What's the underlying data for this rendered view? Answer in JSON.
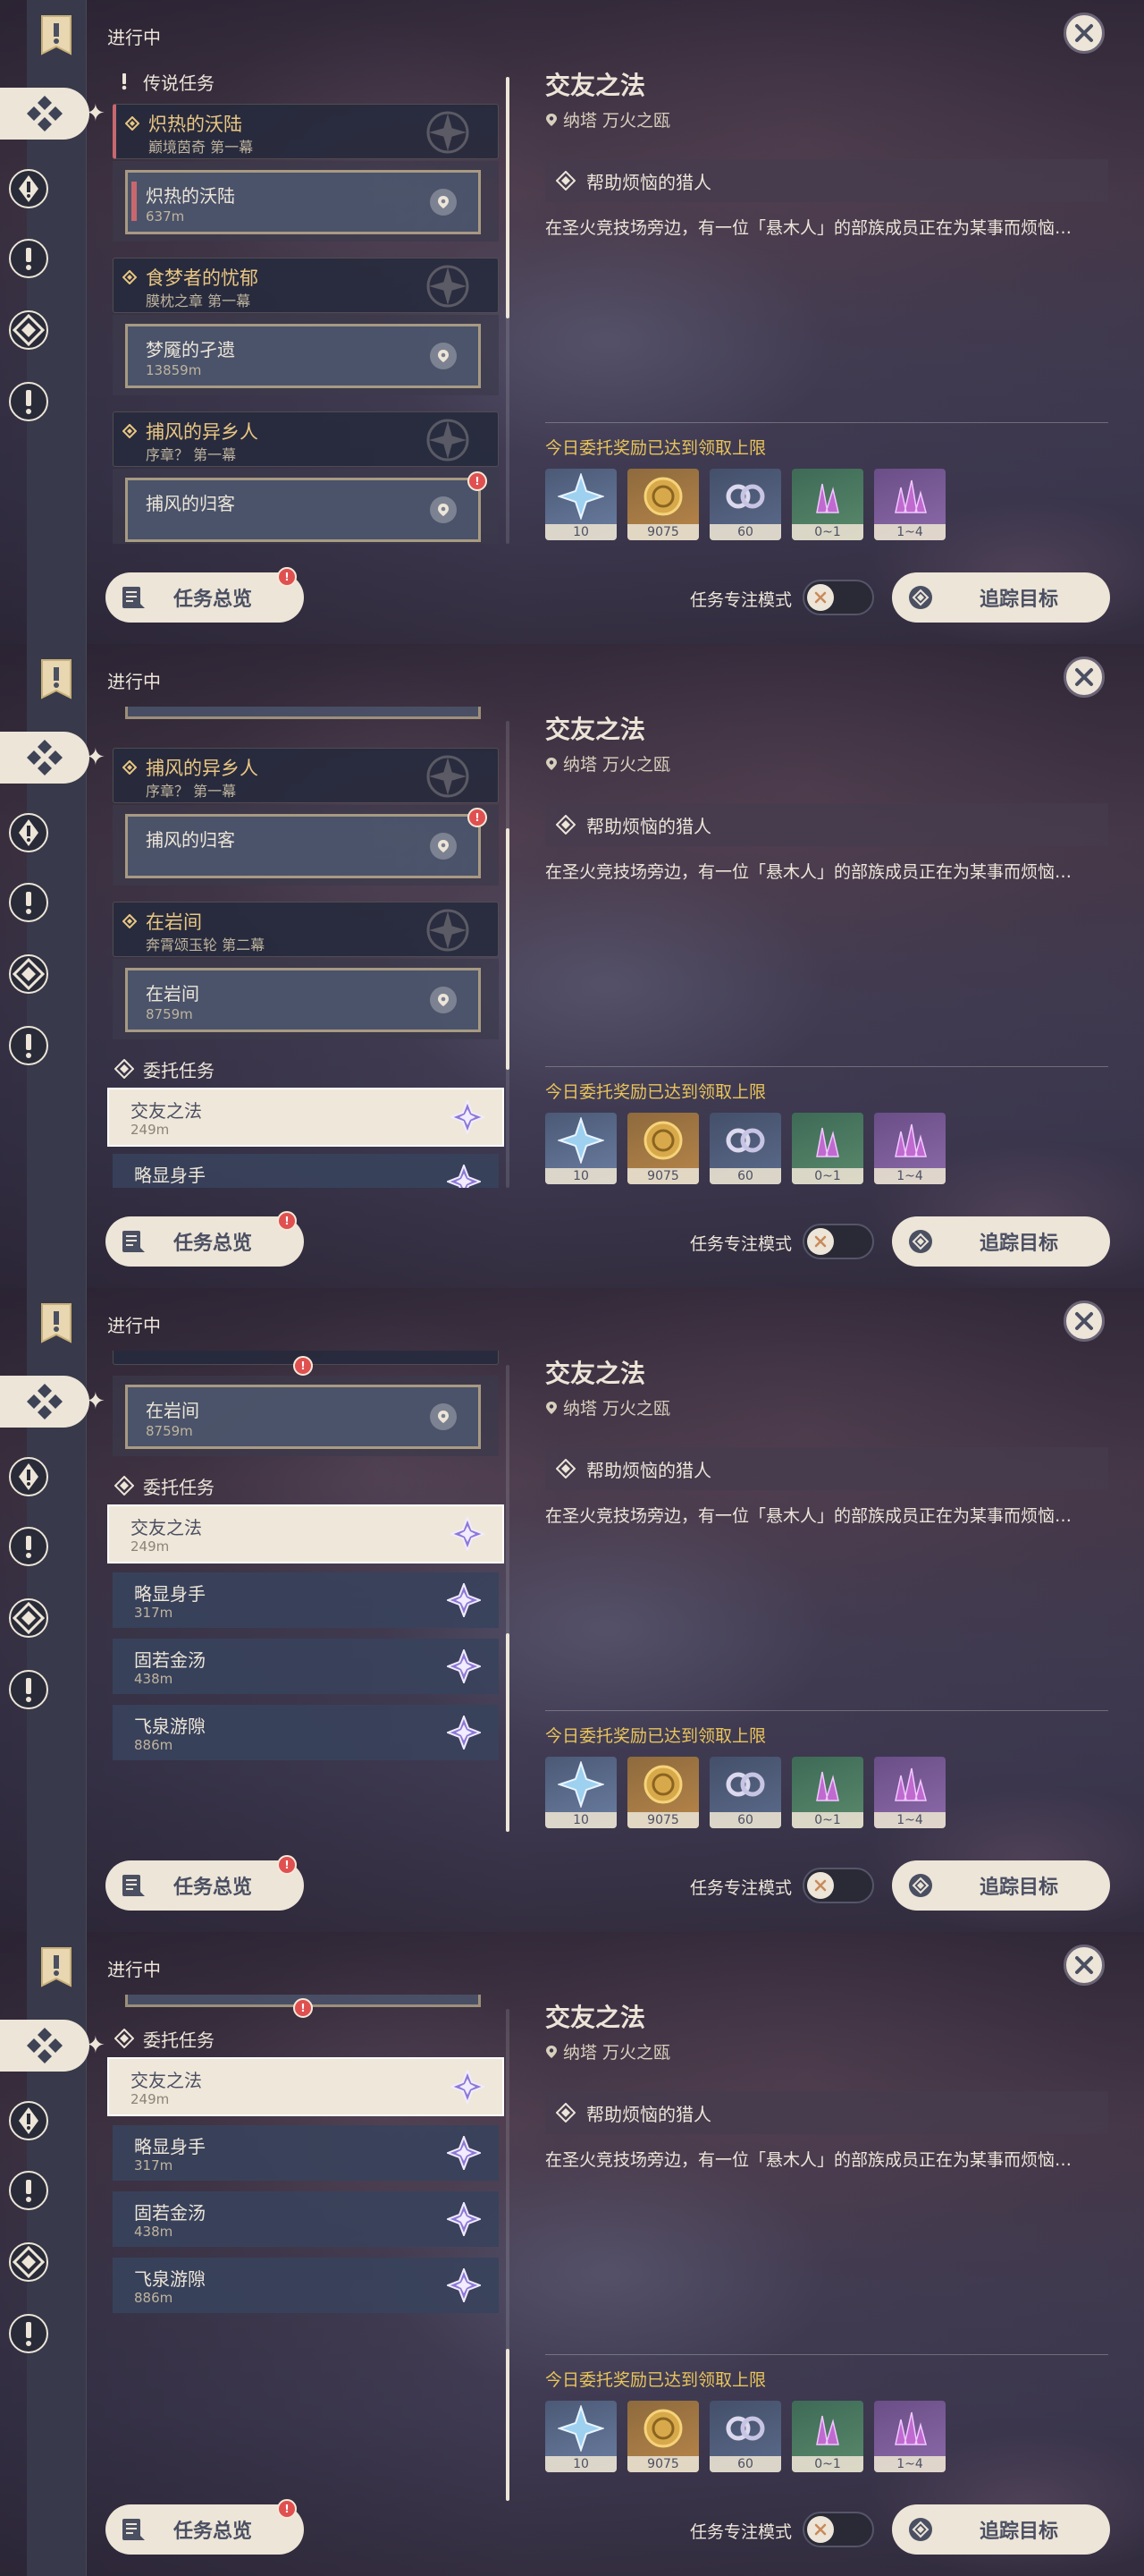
{
  "header": {
    "section_title": "进行中"
  },
  "sections": {
    "legend": "传说任务",
    "commission": "委托任务"
  },
  "legend_arcs": [
    {
      "name": "炽热的沃陆",
      "chapter": "巅境茵奇 第一幕",
      "quest": "炽热的沃陆",
      "distance": "637m"
    },
    {
      "name": "食梦者的忧郁",
      "chapter": "膜枕之章 第一幕",
      "quest": "梦魇的孑遗",
      "distance": "13859m"
    },
    {
      "name": "捕风的异乡人",
      "chapter": "序章？ 第一幕",
      "quest": "捕风的归客",
      "distance": ""
    },
    {
      "name": "在岩间",
      "chapter": "奔霄颂玉轮 第二幕",
      "quest": "在岩间",
      "distance": "8759m"
    }
  ],
  "partials": {
    "p2_top_distance": "13859m",
    "p4_top_distance": "8759m"
  },
  "commissions": [
    {
      "name": "交友之法",
      "distance": "249m"
    },
    {
      "name": "略显身手",
      "distance": "317m"
    },
    {
      "name": "固若金汤",
      "distance": "438m"
    },
    {
      "name": "飞泉游隙",
      "distance": "886m"
    }
  ],
  "detail": {
    "title": "交友之法",
    "location": "纳塔  万火之瓯",
    "objective": "帮助烦恼的猎人",
    "description": "在圣火竞技场旁边，有一位「悬木人」的部族成员正在为某事而烦恼…",
    "reward_note": "今日委托奖励已达到领取上限"
  },
  "rewards": [
    {
      "icon": "intertwined-fate-star-icon",
      "count": "10"
    },
    {
      "icon": "mora-coin-icon",
      "count": "9075"
    },
    {
      "icon": "companionship-exp-icon",
      "count": "60"
    },
    {
      "icon": "green-crystal-icon",
      "count": "0~1"
    },
    {
      "icon": "purple-crystal-icon",
      "count": "1~4"
    }
  ],
  "footer": {
    "overview_label": "任务总览",
    "focus_label": "任务专注模式",
    "track_label": "追踪目标"
  },
  "colors": {
    "gold": "#e9c682",
    "accent_red": "#e05050",
    "cream": "#ece5d8",
    "warning_yellow": "#e9c45b"
  }
}
